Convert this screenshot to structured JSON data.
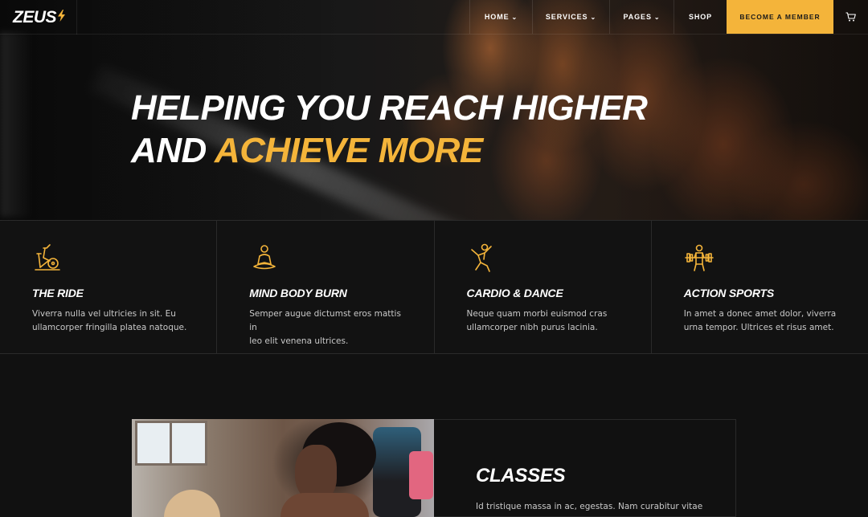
{
  "brand": {
    "name": "ZEUS",
    "accent_color": "#f4b43a",
    "logo_icon": "lightning-bolt-icon"
  },
  "nav": {
    "items": [
      {
        "label": "HOME",
        "has_dropdown": true
      },
      {
        "label": "SERVICES",
        "has_dropdown": true
      },
      {
        "label": "PAGES",
        "has_dropdown": true
      },
      {
        "label": "SHOP",
        "has_dropdown": false
      }
    ],
    "cta_label": "BECOME A MEMBER",
    "cart_icon": "cart-icon"
  },
  "hero": {
    "line1": "HELPING YOU REACH HIGHER",
    "line2_prefix": "AND",
    "line2_accent": "ACHIEVE MORE"
  },
  "features": [
    {
      "title": "THE RIDE",
      "icon": "exercise-bike-icon",
      "text_1": "Viverra nulla vel ultricies in sit. Eu",
      "text_2": "ullamcorper fringilla platea natoque."
    },
    {
      "title": "MIND BODY BURN",
      "icon": "meditation-icon",
      "text_1": "Semper augue dictumst eros mattis in",
      "text_2": "leo elit venena ultrices."
    },
    {
      "title": "CARDIO & DANCE",
      "icon": "dancer-icon",
      "text_1": "Neque quam morbi euismod cras",
      "text_2": "ullamcorper nibh purus lacinia."
    },
    {
      "title": "ACTION SPORTS",
      "icon": "weightlifter-icon",
      "text_1": "In amet a donec amet dolor, viverra",
      "text_2": "urna tempor. Ultrices et risus amet."
    }
  ],
  "classes": {
    "title": "CLASSES",
    "text": "Id tristique massa in ac, egestas. Nam curabitur vitae"
  }
}
